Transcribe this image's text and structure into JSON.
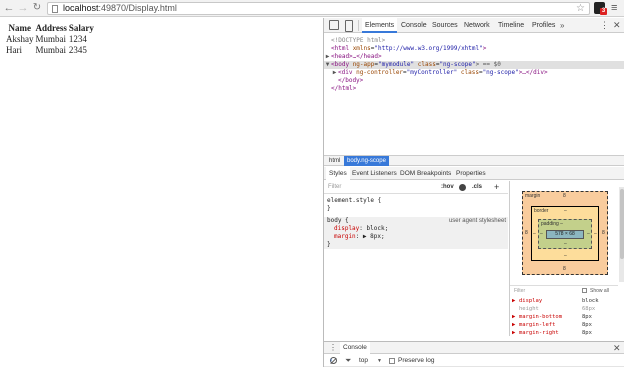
{
  "browser": {
    "url_prefix": "localhost",
    "url_rest": ":49870/Display.html",
    "back_icon": "arrow-left-icon",
    "forward_icon": "arrow-right-icon",
    "reload_icon": "reload-icon",
    "extension_badge": "3"
  },
  "page": {
    "headers": [
      "Name",
      "Address",
      "Salary"
    ],
    "rows": [
      [
        "Akshay",
        "Mumbai",
        "1234"
      ],
      [
        "Hari",
        "Mumbai",
        "2345"
      ]
    ]
  },
  "devtools": {
    "tabs": [
      "Elements",
      "Console",
      "Sources",
      "Network",
      "Timeline",
      "Profiles"
    ],
    "more": "»",
    "dom": {
      "doctype": "<!DOCTYPE html>",
      "html_open_tag": "<html",
      "html_attr_name": "xmlns",
      "html_attr_value": "\"http://www.w3.org/1999/xhtml\"",
      "html_close_bracket": ">",
      "head_tag": "<head>…</head>",
      "body_tag": "<body",
      "body_attr1": "ng-app",
      "body_val1": "\"mymodule\"",
      "body_attr2": "class",
      "body_val2": "\"ng-scope\"",
      "body_suffix": "> == $0",
      "div_tag": "<div",
      "div_attr1": "ng-controller",
      "div_val1": "\"myController\"",
      "div_attr2": "class",
      "div_val2": "\"ng-scope\"",
      "div_close": ">…</div>",
      "body_close": "</body>",
      "html_close": "</html>"
    },
    "breadcrumbs": [
      "html",
      "body.ng-scope"
    ],
    "subtabs": [
      "Styles",
      "Event Listeners",
      "DOM Breakpoints",
      "Properties"
    ],
    "styles": {
      "filter_placeholder": "Filter",
      "hov": ":hov",
      "cls": ".cls",
      "plus": "+",
      "element_style": "element.style {",
      "close_brace": "}",
      "body_selector": "body {",
      "user_agent": "user agent stylesheet",
      "display_prop": "display",
      "display_val": "block;",
      "margin_prop": "margin",
      "margin_val": "▶ 8px;"
    },
    "metrics": {
      "margin_label": "margin",
      "border_label": "border",
      "padding_label": "padding –",
      "content": "578 × 68",
      "margin_top": "8",
      "margin_bottom": "8",
      "margin_left": "8",
      "margin_right": "8",
      "dash": "–"
    },
    "computed": {
      "filter_placeholder": "Filter",
      "show_all": "Show all",
      "rows": [
        {
          "name": "display",
          "value": "block",
          "dim": false
        },
        {
          "name": "height",
          "value": "68px",
          "dim": true
        },
        {
          "name": "margin-bottom",
          "value": "8px",
          "dim": false
        },
        {
          "name": "margin-left",
          "value": "8px",
          "dim": false
        },
        {
          "name": "margin-right",
          "value": "8px",
          "dim": false
        }
      ]
    },
    "drawer": {
      "tab": "Console",
      "context": "top",
      "preserve_log": "Preserve log",
      "prompt": "›"
    },
    "colors": {
      "accent": "#3879d9",
      "margin_box": "#f9cc9d",
      "border_box": "#fddd9b",
      "padding_box": "#c3d08b",
      "content_box": "#8cb6c0"
    }
  }
}
